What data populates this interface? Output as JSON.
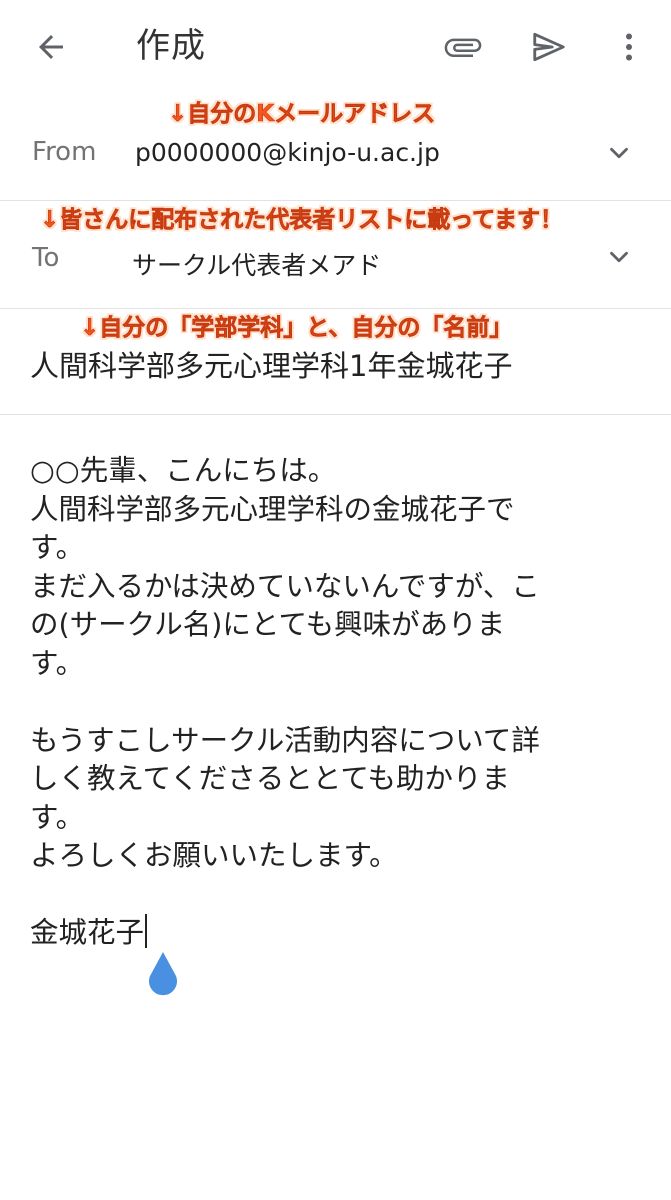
{
  "appbar": {
    "title": "作成",
    "back_icon": "arrow-back-icon",
    "attach_icon": "paperclip-icon",
    "send_icon": "send-icon",
    "more_icon": "more-vert-icon"
  },
  "annotations": {
    "from_note": "↓自分のKメールアドレス",
    "to_note": "↓皆さんに配布された代表者リストに載ってます！",
    "subject_note": "↓自分の「学部学科」と、自分の「名前」",
    "color": "#f4561f"
  },
  "from": {
    "label": "From",
    "value": "p0000000@kinjo-u.ac.jp"
  },
  "to": {
    "label": "To",
    "value": "サークル代表者メアド"
  },
  "subject": {
    "value": "人間科学部多元心理学科1年金城花子"
  },
  "body": {
    "lines": [
      "○○先輩、こんにちは。",
      "人間科学部多元心理学科の金城花子で",
      "す。",
      "まだ入るかは決めていないんですが、こ",
      "の(サークル名)にとても興味がありま",
      "す。",
      "",
      "もうすこしサークル活動内容について詳",
      "しく教えてくださるととても助かりま",
      "す。",
      "よろしくお願いいたします。",
      "",
      "金城花子"
    ]
  },
  "colors": {
    "cursor_handle": "#4a90e2",
    "label_gray": "#737373",
    "icon_gray": "#5f6368"
  }
}
